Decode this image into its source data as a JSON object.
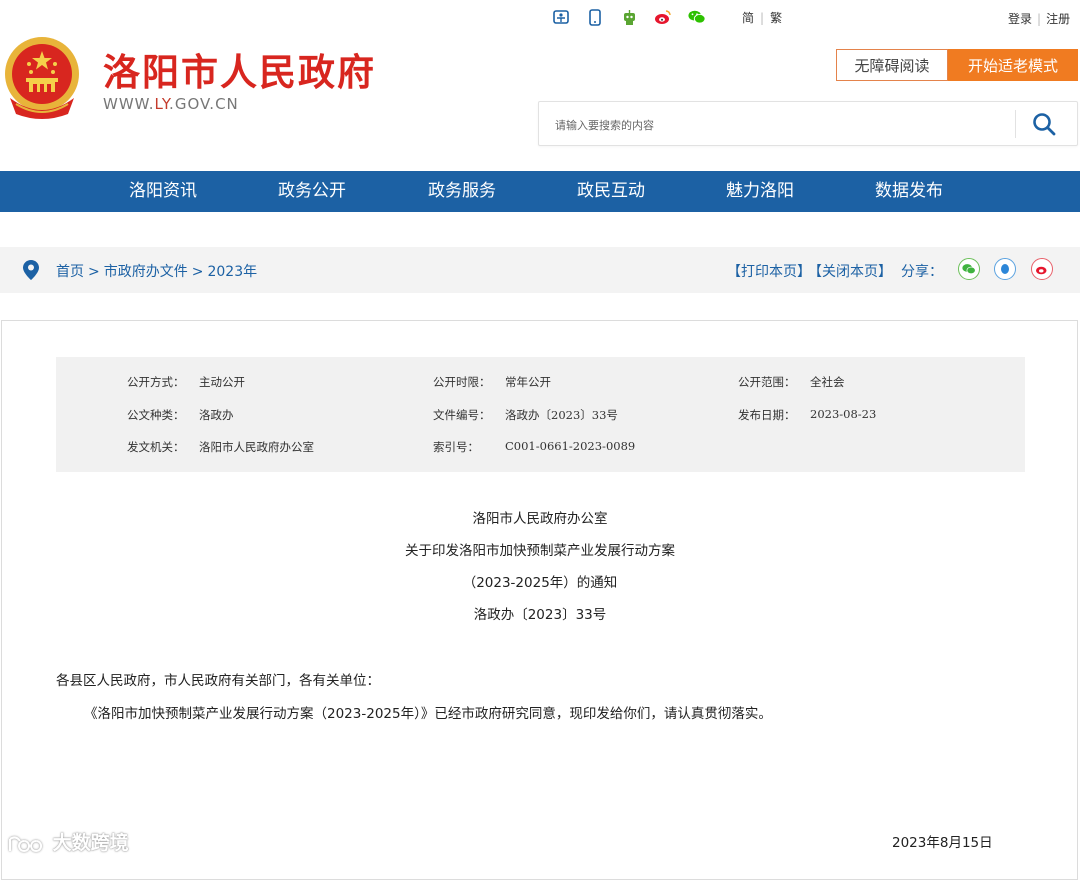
{
  "header": {
    "top_icons": [
      "accessibility-icon",
      "mobile-icon",
      "robot-icon",
      "weibo-icon",
      "wechat-icon"
    ],
    "lang": {
      "simplified": "简",
      "traditional": "繁",
      "separator": "|"
    },
    "auth": {
      "login": "登录",
      "register": "注册",
      "separator": "|"
    },
    "site_name": "洛阳市人民政府",
    "site_url": {
      "prefix": "WWW.",
      "highlight": "LY",
      "suffix": ".GOV.CN"
    },
    "accessible_reading": "无障碍阅读",
    "elder_mode": "开始适老模式",
    "search": {
      "placeholder": "请输入要搜索的内容"
    }
  },
  "nav": {
    "items": [
      "洛阳资讯",
      "政务公开",
      "政务服务",
      "政民互动",
      "魅力洛阳",
      "数据发布"
    ]
  },
  "breadcrumb": {
    "items": [
      "首页",
      "市政府办文件",
      "2023年"
    ],
    "separator": ">",
    "print": "【打印本页】",
    "close": "【关闭本页】",
    "share_label": "分享："
  },
  "meta": {
    "rows": [
      [
        {
          "k": "公开方式：",
          "v": "主动公开"
        },
        {
          "k": "公开时限：",
          "v": "常年公开"
        },
        {
          "k": "公开范围：",
          "v": "全社会"
        }
      ],
      [
        {
          "k": "公文种类：",
          "v": "洛政办"
        },
        {
          "k": "文件编号：",
          "v": "洛政办〔2023〕33号"
        },
        {
          "k": "发布日期：",
          "v": "2023-08-23"
        }
      ],
      [
        {
          "k": "发文机关：",
          "v": "洛阳市人民政府办公室"
        },
        {
          "k": "索引号：",
          "v": "C001-0661-2023-0089"
        },
        {
          "k": "",
          "v": ""
        }
      ]
    ]
  },
  "document": {
    "issuer": "洛阳市人民政府办公室",
    "title_line1": "关于印发洛阳市加快预制菜产业发展行动方案",
    "title_line2": "（2023-2025年）的通知",
    "doc_no": "洛政办〔2023〕33号",
    "salutation": "各县区人民政府，市人民政府有关部门，各有关单位：",
    "paragraph": "《洛阳市加快预制菜产业发展行动方案（2023-2025年）》已经市政府研究同意，现印发给你们，请认真贯彻落实。",
    "date": "2023年8月15日"
  },
  "watermark": "大数跨境",
  "colors": {
    "brand_red": "#d8261f",
    "nav_blue": "#1c61a4",
    "elder_orange": "#f07b21",
    "meta_bg": "#f1f1f1"
  }
}
